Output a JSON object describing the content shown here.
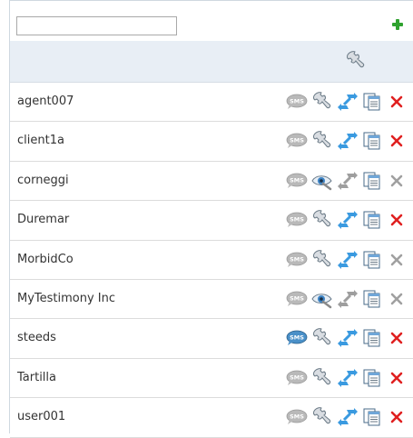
{
  "toolbar": {
    "search_value": "",
    "add_icon": "plus-icon"
  },
  "header": {
    "icon": "wrench-icon"
  },
  "colors": {
    "delete_active": "#e02020",
    "delete_disabled": "#a0a0a0",
    "add": "#2fa22f",
    "header_bg": "#e8eef5"
  },
  "rows": [
    {
      "name": "agent007",
      "sms_active": false,
      "tool": "wrench",
      "enabled": true
    },
    {
      "name": "client1a",
      "sms_active": false,
      "tool": "wrench",
      "enabled": true
    },
    {
      "name": "corneggi",
      "sms_active": false,
      "tool": "eye",
      "enabled": false
    },
    {
      "name": "Duremar",
      "sms_active": false,
      "tool": "wrench",
      "enabled": true
    },
    {
      "name": "MorbidCo",
      "sms_active": false,
      "tool": "wrench",
      "enabled": true,
      "delete_disabled": true
    },
    {
      "name": "MyTestimony Inc",
      "sms_active": false,
      "tool": "eye",
      "enabled": false
    },
    {
      "name": "steeds",
      "sms_active": true,
      "tool": "wrench",
      "enabled": true
    },
    {
      "name": "Tartilla",
      "sms_active": false,
      "tool": "wrench",
      "enabled": true
    },
    {
      "name": "user001",
      "sms_active": false,
      "tool": "wrench",
      "enabled": true
    }
  ],
  "icon_labels": {
    "sms": "SMS"
  }
}
